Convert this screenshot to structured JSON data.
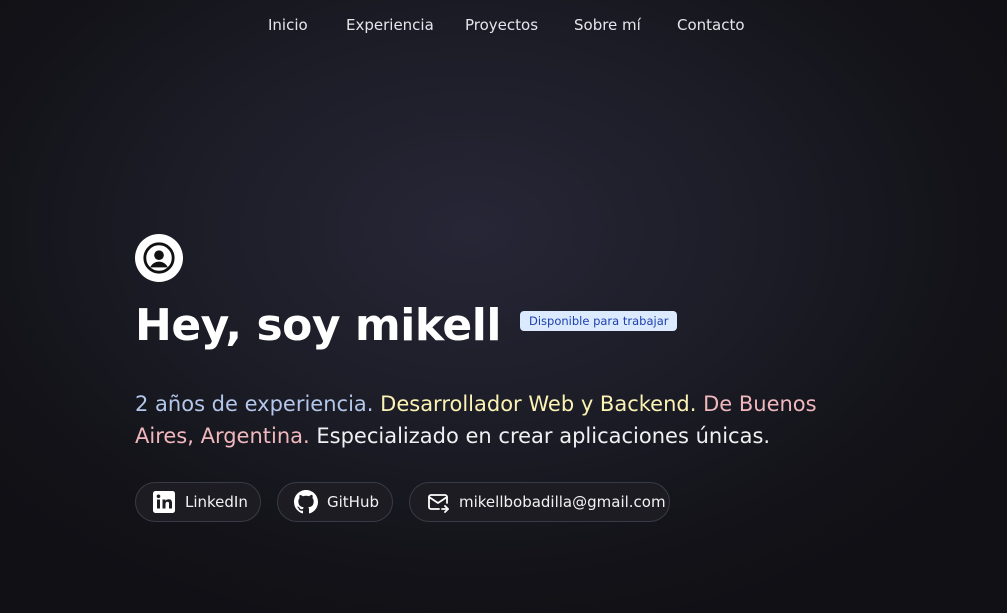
{
  "nav": {
    "items": [
      {
        "label": "Inicio"
      },
      {
        "label": "Experiencia"
      },
      {
        "label": "Proyectos"
      },
      {
        "label": "Sobre mí"
      },
      {
        "label": "Contacto"
      }
    ]
  },
  "hero": {
    "avatar_icon": "user-circle-icon",
    "title": "Hey, soy mikell",
    "badge": "Disponible para trabajar",
    "description": {
      "experience": "2 años de experiencia.",
      "role": "Desarrollador Web y Backend.",
      "location": "De Buenos Aires, Argentina.",
      "specialty": "Especializado en crear aplicaciones únicas."
    },
    "colors": {
      "experience": "#b3c7ea",
      "role": "#fbf2b4",
      "location": "#f0b8bd",
      "badge_bg": "#dbeafe",
      "badge_text": "#1e40af"
    }
  },
  "socials": [
    {
      "label": "LinkedIn",
      "icon": "linkedin-icon"
    },
    {
      "label": "GitHub",
      "icon": "github-icon"
    },
    {
      "label": "mikellbobadilla@gmail.com",
      "icon": "mail-icon"
    }
  ]
}
